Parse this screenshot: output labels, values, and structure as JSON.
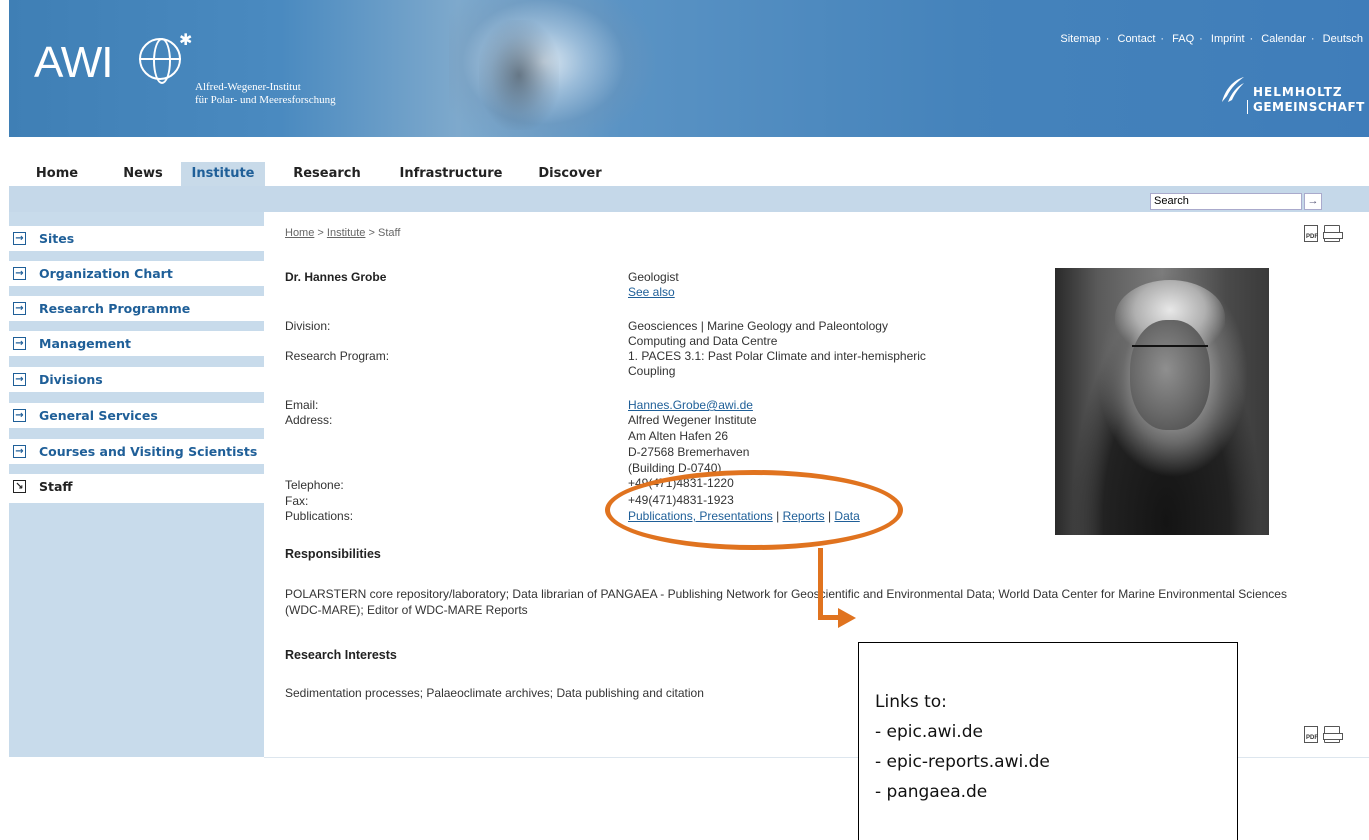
{
  "header": {
    "logo_text": "AWI",
    "institute_line1": "Alfred-Wegener-Institut",
    "institute_line2": "für Polar- und Meeresforschung",
    "top_links": [
      "Sitemap",
      "Contact",
      "FAQ",
      "Imprint",
      "Calendar",
      "Deutsch"
    ],
    "helmholtz_line1": "HELMHOLTZ",
    "helmholtz_line2": "GEMEINSCHAFT"
  },
  "main_nav": [
    "Home",
    "News",
    "Institute",
    "Research",
    "Infrastructure",
    "Discover"
  ],
  "main_nav_active": "Institute",
  "search": {
    "value": "Search",
    "button": "→"
  },
  "sidebar": [
    "Sites",
    "Organization Chart",
    "Research Programme",
    "Management",
    "Divisions",
    "General Services",
    "Courses and Visiting Scientists",
    "Staff"
  ],
  "breadcrumb": {
    "home": "Home",
    "sep": ">",
    "institute": "Institute",
    "current": "Staff"
  },
  "profile": {
    "name": "Dr. Hannes Grobe",
    "title": "Geologist",
    "see_also": "See also",
    "division_label": "Division:",
    "division_value1": "Geosciences | Marine Geology and Paleontology",
    "division_value2": "Computing and Data Centre",
    "program_label": "Research Program:",
    "program_value1": "1. PACES 3.1: Past Polar Climate and inter-hemispheric",
    "program_value2": "Coupling",
    "email_label": "Email:",
    "email_value": "Hannes.Grobe@awi.de",
    "address_label": "Address:",
    "address_lines": [
      "Alfred Wegener Institute",
      "Am Alten Hafen 26",
      "D-27568 Bremerhaven",
      "(Building D-0740)"
    ],
    "telephone_label": "Telephone:",
    "telephone_value": "+49(471)4831-1220",
    "fax_label": "Fax:",
    "fax_value": "+49(471)4831-1923",
    "publications_label": "Publications:",
    "pub_link1": "Publications, Presentations",
    "pub_sep": "|",
    "pub_link2": "Reports",
    "pub_link3": "Data"
  },
  "responsibilities": {
    "heading": "Responsibilities",
    "text": "POLARSTERN core repository/laboratory; Data librarian of PANGAEA - Publishing Network for Geoscientific and Environmental Data; World Data Center for Marine Environmental Sciences (WDC-MARE); Editor of WDC-MARE Reports"
  },
  "research_interests": {
    "heading": "Research Interests",
    "text": "Sedimentation processes; Palaeoclimate archives; Data publishing and citation"
  },
  "annotation": {
    "title": "Links to:",
    "items": [
      "- epic.awi.de",
      "- epic-reports.awi.de",
      "- pangaea.de"
    ],
    "color": "#e0731f"
  },
  "icons": {
    "pdf_label": "PDF"
  },
  "colors": {
    "header_blue": "#4583bb",
    "nav_bar": "#c5d8e9",
    "link": "#1f5f98"
  }
}
